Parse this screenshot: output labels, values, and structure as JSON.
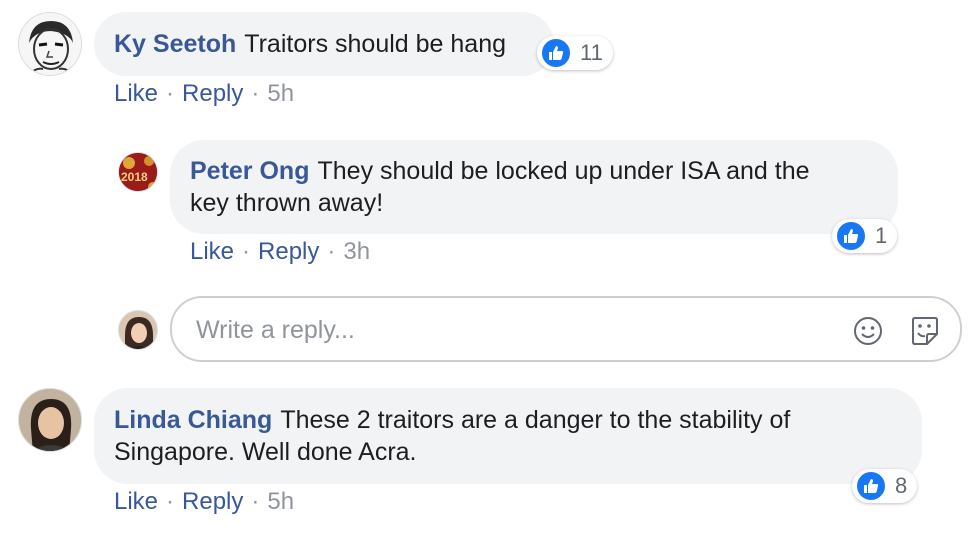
{
  "comments": [
    {
      "author": "Ky Seetoh",
      "text": "Traitors should be hang",
      "actions": {
        "like": "Like",
        "reply": "Reply",
        "time": "5h"
      },
      "reactions": "11",
      "replies": [
        {
          "author": "Peter Ong",
          "text_line1": "They should be locked up under ISA and the",
          "text_line2": "key thrown away!",
          "actions": {
            "like": "Like",
            "reply": "Reply",
            "time": "3h"
          },
          "reactions": "1"
        }
      ],
      "reply_box": {
        "placeholder": "Write a reply...",
        "icons": [
          "smiley-icon",
          "sticker-icon"
        ]
      }
    },
    {
      "author": "Linda Chiang",
      "text_line1": "These 2 traitors are a danger to the stability of",
      "text_line2": "Singapore. Well done Acra.",
      "actions": {
        "like": "Like",
        "reply": "Reply",
        "time": "5h"
      },
      "reactions": "8"
    }
  ],
  "separator": "·",
  "colors": {
    "link": "#385898",
    "bubble": "#f2f3f5",
    "like_blue": "#1877f2",
    "meta_gray": "#90949c"
  }
}
